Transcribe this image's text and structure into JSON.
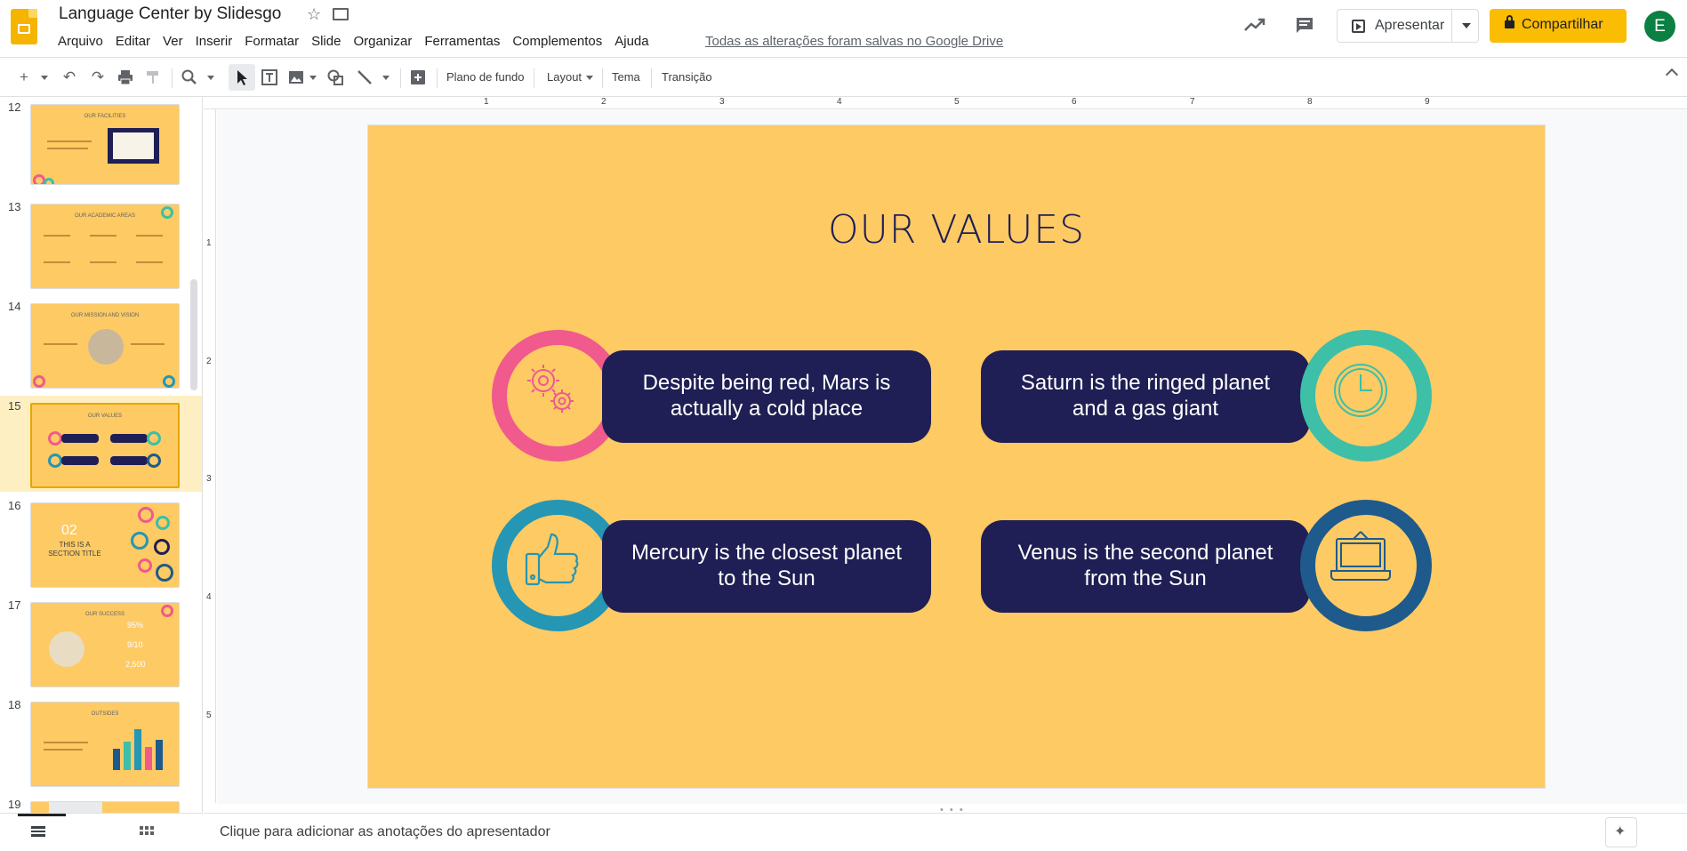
{
  "app": {
    "title": "Language Center by Slidesgo",
    "saved_status": "Todas as alterações foram salvas no Google Drive",
    "avatar_initial": "E"
  },
  "menu": [
    "Arquivo",
    "Editar",
    "Ver",
    "Inserir",
    "Formatar",
    "Slide",
    "Organizar",
    "Ferramentas",
    "Complementos",
    "Ajuda"
  ],
  "header_actions": {
    "present_label": "Apresentar",
    "share_label": "Compartilhar"
  },
  "toolbar": {
    "background_label": "Plano de fundo",
    "layout_label": "Layout",
    "theme_label": "Tema",
    "transition_label": "Transição"
  },
  "rulers": {
    "top": [
      "1",
      "2",
      "3",
      "4",
      "5",
      "6",
      "7",
      "8",
      "9"
    ],
    "left": [
      "1",
      "2",
      "3",
      "4",
      "5"
    ]
  },
  "slides": [
    {
      "number": "12",
      "caption": "OUR FACILITIES"
    },
    {
      "number": "13",
      "caption": "OUR ACADEMIC AREAS"
    },
    {
      "number": "14",
      "caption": "OUR MISSION AND VISION"
    },
    {
      "number": "15",
      "caption": "OUR VALUES",
      "selected": true
    },
    {
      "number": "16",
      "caption": "02",
      "subcaption": "THIS IS A SECTION TITLE"
    },
    {
      "number": "17",
      "caption": "OUR SUCCESS",
      "stats": [
        "95%",
        "9/10",
        "2,500"
      ]
    },
    {
      "number": "18",
      "caption": "OUTSIDES"
    },
    {
      "number": "19",
      "caption": ""
    }
  ],
  "current_slide": {
    "title": "OUR VALUES",
    "values": [
      {
        "text": "Despite being red, Mars is actually a cold place",
        "icon": "gears-icon",
        "color": "#f05a8c"
      },
      {
        "text": "Saturn is the ringed planet and a gas giant",
        "icon": "clock-icon",
        "color": "#3dbfa8"
      },
      {
        "text": "Mercury is the closest planet to the Sun",
        "icon": "thumbs-up-icon",
        "color": "#2596b3"
      },
      {
        "text": "Venus is the second planet from the Sun",
        "icon": "laptop-icon",
        "color": "#1e5a8c"
      }
    ],
    "colors": {
      "background": "#fdca64",
      "pill": "#1f1f55",
      "title": "#1f1f55"
    }
  },
  "notes": {
    "placeholder": "Clique para adicionar as anotações do apresentador"
  }
}
